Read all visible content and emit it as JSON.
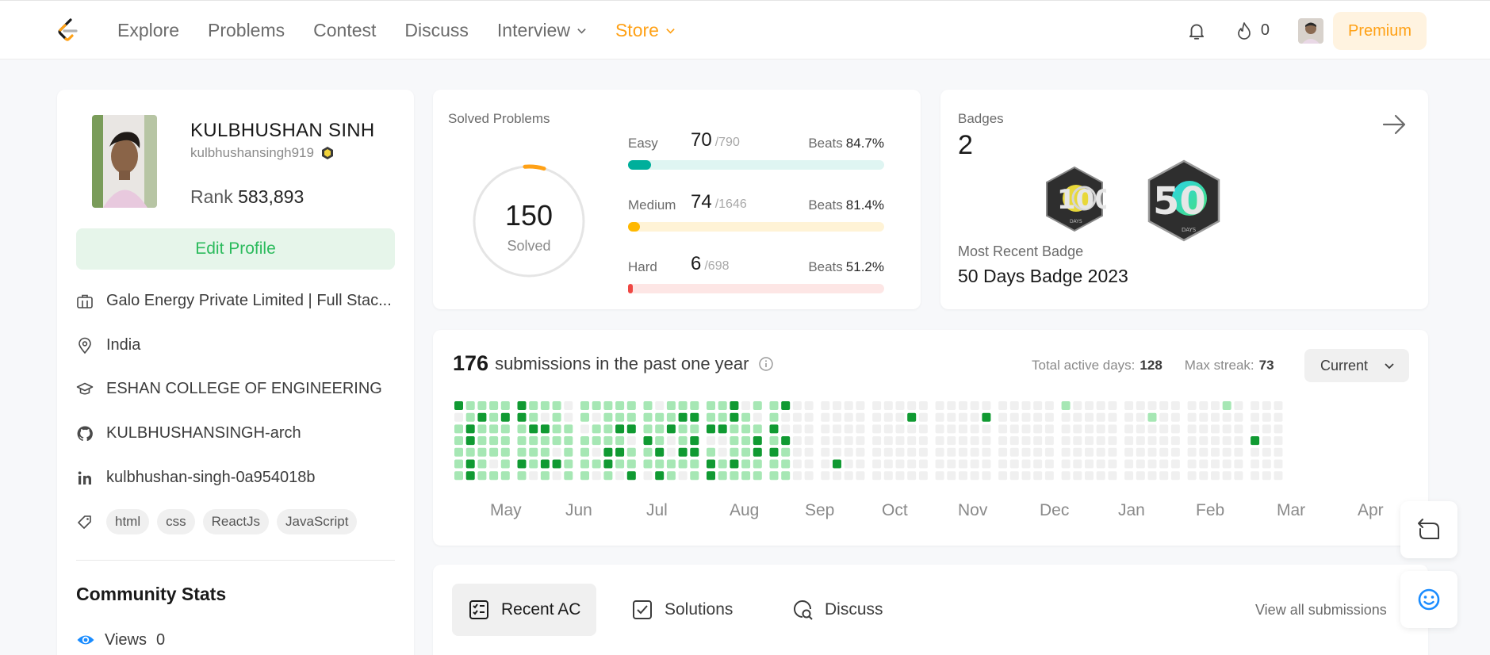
{
  "nav": {
    "links": [
      "Explore",
      "Problems",
      "Contest",
      "Discuss",
      "Interview",
      "Store"
    ],
    "streak_count": "0",
    "premium_label": "Premium",
    "accent": "#ffa116"
  },
  "profile": {
    "name": "KULBHUSHAN SINH",
    "username": "kulbhushansingh919",
    "rank_label": "Rank",
    "rank_value": "583,893",
    "edit_label": "Edit Profile",
    "company": "Galo Energy Private Limited | Full Stac...",
    "location": "India",
    "school": "ESHAN COLLEGE OF ENGINEERING",
    "github": "KULBHUSHANSINGH-arch",
    "linkedin": "kulbhushan-singh-0a954018b",
    "skills": [
      "html",
      "css",
      "ReactJs",
      "JavaScript"
    ],
    "community_title": "Community Stats",
    "views_label": "Views",
    "views_value": "0"
  },
  "solved": {
    "title": "Solved Problems",
    "total": "150",
    "total_label": "Solved",
    "difficulties": [
      {
        "label": "Easy",
        "count": "70",
        "total": "/790",
        "beats_label": "Beats",
        "beats": "84.7%",
        "fraction": 0.0886,
        "color": "#00af9b",
        "track": "#dff5f2"
      },
      {
        "label": "Medium",
        "count": "74",
        "total": "/1646",
        "beats_label": "Beats",
        "beats": "81.4%",
        "fraction": 0.045,
        "color": "#ffb800",
        "track": "#fff3d6"
      },
      {
        "label": "Hard",
        "count": "6",
        "total": "/698",
        "beats_label": "Beats",
        "beats": "51.2%",
        "fraction": 0.0086,
        "color": "#ef4743",
        "track": "#fde6e5"
      }
    ]
  },
  "badges": {
    "title": "Badges",
    "count": "2",
    "items": [
      {
        "name": "100 Days Badge",
        "number": "100",
        "sub": "DAYS"
      },
      {
        "name": "50 Days Badge 2023",
        "number": "50",
        "sub": "DAYS"
      }
    ],
    "recent_label": "Most Recent Badge",
    "recent_name": "50 Days Badge 2023"
  },
  "calendar": {
    "count": "176",
    "heading": "submissions in the past one year",
    "active_days_label": "Total active days:",
    "active_days": "128",
    "max_streak_label": "Max streak:",
    "max_streak": "73",
    "select_value": "Current",
    "months": [
      "May",
      "Jun",
      "Jul",
      "Aug",
      "Sep",
      "Oct",
      "Nov",
      "Dec",
      "Jan",
      "Feb",
      "Mar",
      "Apr"
    ],
    "colors": {
      "empty": "#f0f0f0",
      "light": "#a6e7b4",
      "dark": "#109a32"
    }
  },
  "tabs": {
    "items": [
      "Recent AC",
      "Solutions",
      "Discuss"
    ],
    "view_all": "View all submissions"
  }
}
